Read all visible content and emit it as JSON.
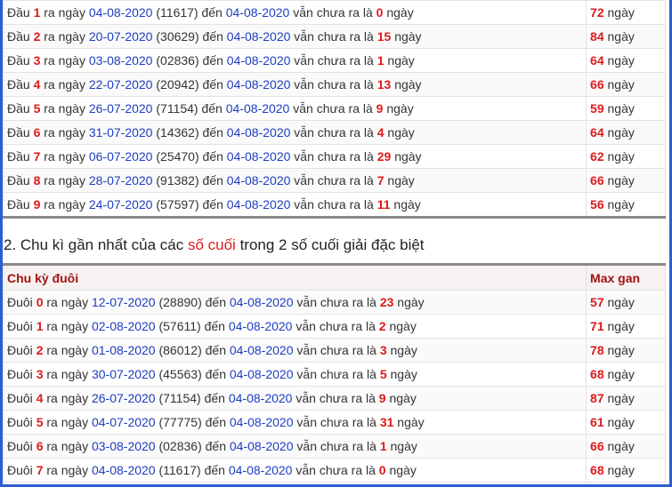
{
  "word_ra_ngay": "ra ngày",
  "word_den": "đến",
  "word_van_chua": "vẫn chưa ra là",
  "word_ngay": "ngày",
  "table1": {
    "prefix": "Đầu",
    "rows": [
      {
        "digit": "1",
        "date": "04-08-2020",
        "code": "(11617)",
        "to": "04-08-2020",
        "days": "0",
        "max": "72"
      },
      {
        "digit": "2",
        "date": "20-07-2020",
        "code": "(30629)",
        "to": "04-08-2020",
        "days": "15",
        "max": "84"
      },
      {
        "digit": "3",
        "date": "03-08-2020",
        "code": "(02836)",
        "to": "04-08-2020",
        "days": "1",
        "max": "64"
      },
      {
        "digit": "4",
        "date": "22-07-2020",
        "code": "(20942)",
        "to": "04-08-2020",
        "days": "13",
        "max": "66"
      },
      {
        "digit": "5",
        "date": "26-07-2020",
        "code": "(71154)",
        "to": "04-08-2020",
        "days": "9",
        "max": "59"
      },
      {
        "digit": "6",
        "date": "31-07-2020",
        "code": "(14362)",
        "to": "04-08-2020",
        "days": "4",
        "max": "64"
      },
      {
        "digit": "7",
        "date": "06-07-2020",
        "code": "(25470)",
        "to": "04-08-2020",
        "days": "29",
        "max": "62"
      },
      {
        "digit": "8",
        "date": "28-07-2020",
        "code": "(91382)",
        "to": "04-08-2020",
        "days": "7",
        "max": "66"
      },
      {
        "digit": "9",
        "date": "24-07-2020",
        "code": "(57597)",
        "to": "04-08-2020",
        "days": "11",
        "max": "56"
      }
    ]
  },
  "section2": {
    "title_pre": "2. Chu kì gần nhất của các ",
    "title_hl": "số cuối",
    "title_post": " trong 2 số cuối giải đặc biệt"
  },
  "table2": {
    "header_col1": "Chu kỳ đuôi",
    "header_col2": "Max gan",
    "prefix": "Đuôi",
    "rows": [
      {
        "digit": "0",
        "date": "12-07-2020",
        "code": "(28890)",
        "to": "04-08-2020",
        "days": "23",
        "max": "57"
      },
      {
        "digit": "1",
        "date": "02-08-2020",
        "code": "(57611)",
        "to": "04-08-2020",
        "days": "2",
        "max": "71"
      },
      {
        "digit": "2",
        "date": "01-08-2020",
        "code": "(86012)",
        "to": "04-08-2020",
        "days": "3",
        "max": "78"
      },
      {
        "digit": "3",
        "date": "30-07-2020",
        "code": "(45563)",
        "to": "04-08-2020",
        "days": "5",
        "max": "68"
      },
      {
        "digit": "4",
        "date": "26-07-2020",
        "code": "(71154)",
        "to": "04-08-2020",
        "days": "9",
        "max": "87"
      },
      {
        "digit": "5",
        "date": "04-07-2020",
        "code": "(77775)",
        "to": "04-08-2020",
        "days": "31",
        "max": "61"
      },
      {
        "digit": "6",
        "date": "03-08-2020",
        "code": "(02836)",
        "to": "04-08-2020",
        "days": "1",
        "max": "66"
      },
      {
        "digit": "7",
        "date": "04-08-2020",
        "code": "(11617)",
        "to": "04-08-2020",
        "days": "0",
        "max": "68"
      }
    ]
  }
}
